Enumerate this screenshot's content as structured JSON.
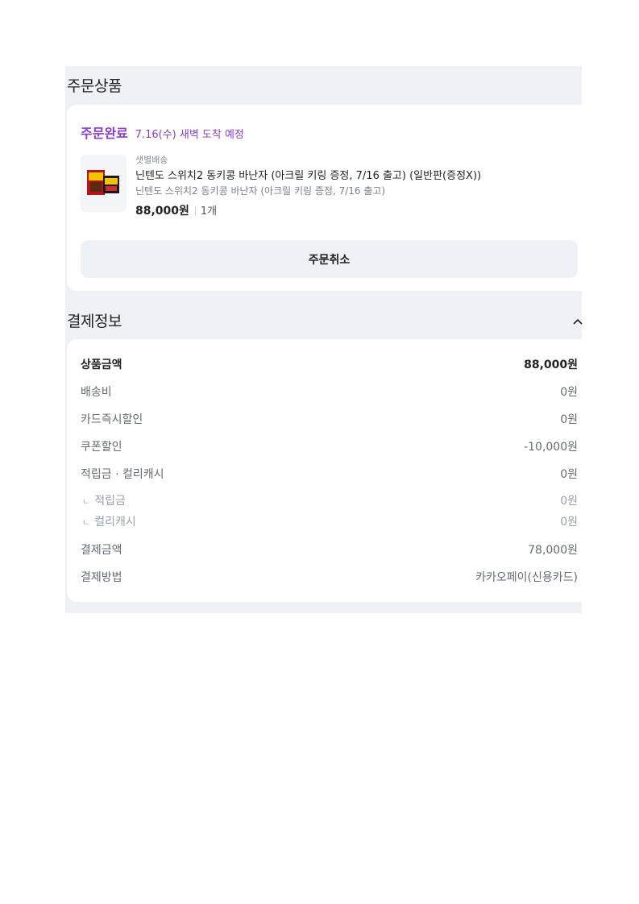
{
  "order_section": {
    "title": "주문상품",
    "status_label": "주문완료",
    "status_date": "7.16(수) 새벽 도착 예정",
    "product": {
      "delivery_type": "샛별배송",
      "name": "닌텐도 스위치2 동키콩 바난자 (아크릴 키링 증정, 7/16 출고) (일반판(증정X))",
      "option": "닌텐도 스위치2 동키콩 바난자 (아크릴 키링 증정, 7/16 출고)",
      "price": "88,000원",
      "quantity": "1개",
      "thumbnail_icon": "product-thumbnail-icon"
    },
    "cancel_label": "주문취소"
  },
  "payment_section": {
    "title": "결제정보",
    "toggle_icon": "chevron-up-icon",
    "rows": [
      {
        "label": "상품금액",
        "value": "88,000원"
      },
      {
        "label": "배송비",
        "value": "0원"
      },
      {
        "label": "카드즉시할인",
        "value": "0원"
      },
      {
        "label": "쿠폰할인",
        "value": "-10,000원"
      },
      {
        "label": "적립금 · 컬리캐시",
        "value": "0원"
      },
      {
        "label": "적립금",
        "value": "0원"
      },
      {
        "label": "컬리캐시",
        "value": "0원"
      },
      {
        "label": "결제금액",
        "value": "78,000원"
      },
      {
        "label": "결제방법",
        "value": "카카오페이(신용카드)"
      }
    ]
  },
  "colors": {
    "accent": "#8a3ccf",
    "panel_bg": "#eef1f5"
  }
}
